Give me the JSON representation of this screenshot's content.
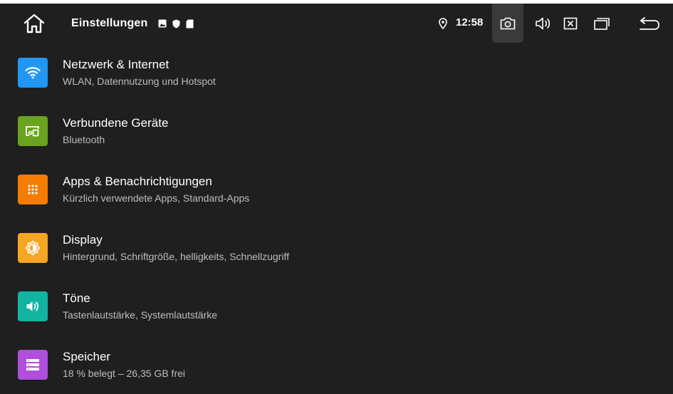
{
  "status_bar": {
    "title": "Einstellungen",
    "time": "12:58",
    "notification_icons": [
      "image-icon",
      "shield-icon",
      "sd-card-icon"
    ]
  },
  "settings": [
    {
      "title": "Netzwerk & Internet",
      "subtitle": "WLAN, Datennutzung und Hotspot",
      "icon": "wifi-icon",
      "color": "#2196f3"
    },
    {
      "title": "Verbundene Geräte",
      "subtitle": "Bluetooth",
      "icon": "devices-icon",
      "color": "#6aa31f"
    },
    {
      "title": "Apps & Benachrichtigungen",
      "subtitle": "Kürzlich verwendete Apps, Standard-Apps",
      "icon": "apps-grid-icon",
      "color": "#f57c00"
    },
    {
      "title": "Display",
      "subtitle": "Hintergrund, Schriftgröße, helligkeits, Schnellzugriff",
      "icon": "brightness-icon",
      "color": "#f5a623"
    },
    {
      "title": "Töne",
      "subtitle": "Tastenlautstärke, Systemlautstärke",
      "icon": "speaker-icon",
      "color": "#12b3a3"
    },
    {
      "title": "Speicher",
      "subtitle": "18 % belegt – 26,35 GB frei",
      "icon": "storage-icon",
      "color": "#b04fdb"
    }
  ]
}
